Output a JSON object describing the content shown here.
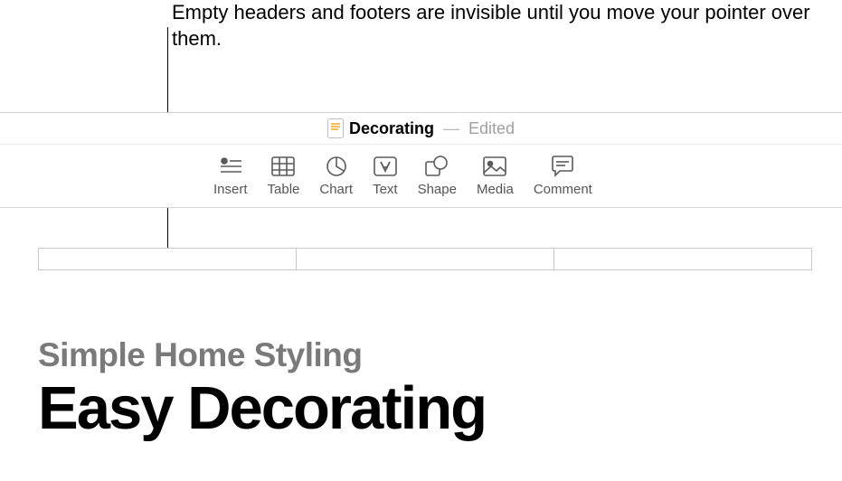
{
  "callout": {
    "text": "Empty headers and footers are invisible until you move your pointer over them."
  },
  "titlebar": {
    "doc_name": "Decorating",
    "separator": "—",
    "status": "Edited"
  },
  "toolbar": {
    "items": [
      {
        "label": "Insert",
        "icon": "insert-icon"
      },
      {
        "label": "Table",
        "icon": "table-icon"
      },
      {
        "label": "Chart",
        "icon": "chart-icon"
      },
      {
        "label": "Text",
        "icon": "text-icon"
      },
      {
        "label": "Shape",
        "icon": "shape-icon"
      },
      {
        "label": "Media",
        "icon": "media-icon"
      },
      {
        "label": "Comment",
        "icon": "comment-icon"
      }
    ]
  },
  "document": {
    "subtitle": "Simple Home Styling",
    "title": "Easy Decorating"
  }
}
